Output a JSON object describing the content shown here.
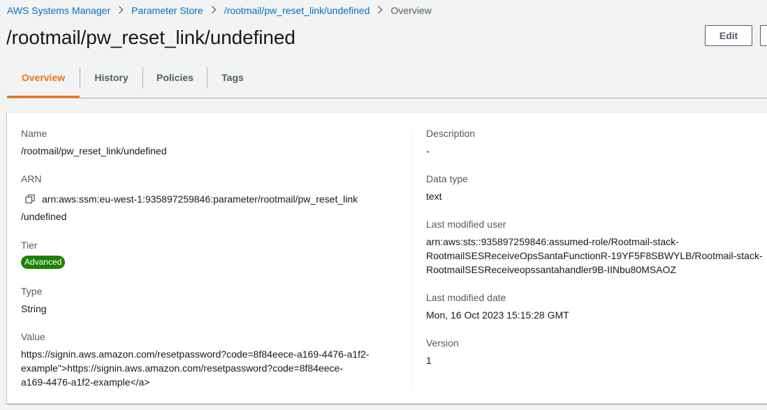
{
  "breadcrumb": {
    "items": [
      "AWS Systems Manager",
      "Parameter Store",
      "/rootmail/pw_reset_link/undefined"
    ],
    "current": "Overview"
  },
  "page": {
    "title": "/rootmail/pw_reset_link/undefined"
  },
  "actions": {
    "edit_label": "Edit"
  },
  "tabs": [
    {
      "label": "Overview",
      "active": true
    },
    {
      "label": "History",
      "active": false
    },
    {
      "label": "Policies",
      "active": false
    },
    {
      "label": "Tags",
      "active": false
    }
  ],
  "details": {
    "left": {
      "name": {
        "label": "Name",
        "value": "/rootmail/pw_reset_link/undefined"
      },
      "arn": {
        "label": "ARN",
        "line1": "arn:aws:ssm:eu-west-1:935897259846:parameter/rootmail/pw_reset_link",
        "line2": "/undefined"
      },
      "tier": {
        "label": "Tier",
        "value": "Advanced"
      },
      "type": {
        "label": "Type",
        "value": "String"
      },
      "value": {
        "label": "Value",
        "lines": [
          "https://signin.aws.amazon.com/resetpassword?code=8f84eece-a169-4476-a1f2-",
          "example\">https://signin.aws.amazon.com/resetpassword?code=8f84eece-",
          "a169-4476-a1f2-example</a>"
        ]
      }
    },
    "right": {
      "description": {
        "label": "Description",
        "value": "-"
      },
      "data_type": {
        "label": "Data type",
        "value": "text"
      },
      "last_modified_user": {
        "label": "Last modified user",
        "lines": [
          "arn:aws:sts::935897259846:assumed-role/Rootmail-stack-",
          "RootmailSESReceiveOpsSantaFunctionR-19YF5F8SBWYLB/Rootmail-stack-",
          "RootmailSESReceiveopssantahandler9B-IINbu80MSAOZ"
        ]
      },
      "last_modified_date": {
        "label": "Last modified date",
        "value": "Mon, 16 Oct 2023 15:15:28 GMT"
      },
      "version": {
        "label": "Version",
        "value": "1"
      }
    }
  },
  "colors": {
    "link": "#0073bb",
    "tab_active": "#ec7211",
    "badge_green": "#1d8102"
  },
  "icons": {
    "breadcrumb_separator": "chevron-right-icon",
    "arn_copy": "copy-icon"
  }
}
